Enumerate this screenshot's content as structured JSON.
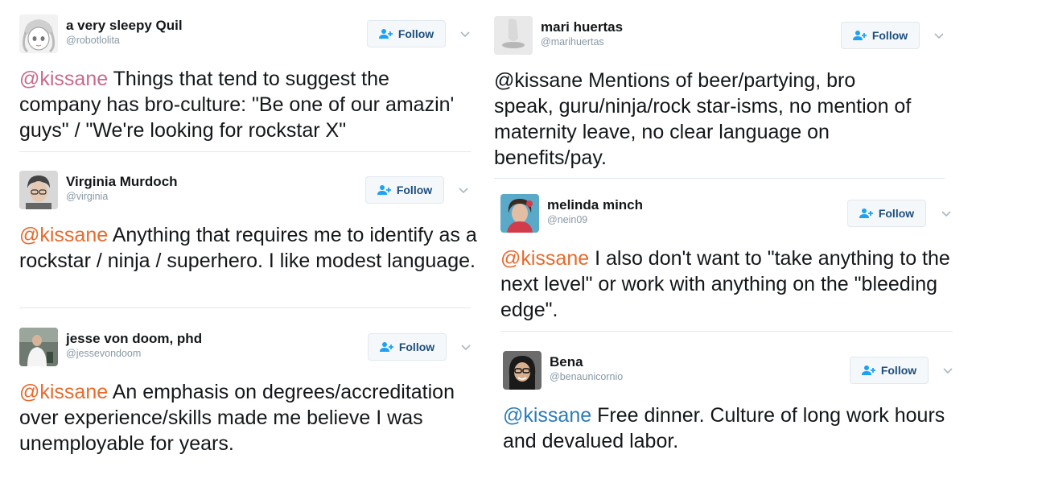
{
  "accent_mention_colors": {
    "pink": "#c96a8a",
    "orange": "#e86a2c",
    "blue": "#2b7bb9"
  },
  "tweets": [
    {
      "name": "a very sleepy Quil",
      "handle": "@robotlolita",
      "follow_label": "Follow",
      "mention": "@kissane",
      "text": " Things that tend to suggest the company has bro-culture: \"Be one of our amazin' guys\" / \"We're looking for rockstar X\"",
      "avatar_icon": "cartoon-girl-avatar"
    },
    {
      "name": "Virginia Murdoch",
      "handle": "@virginia",
      "follow_label": "Follow",
      "mention": "@kissane",
      "text": " Anything that requires me to identify as a rockstar / ninja / superhero. I like modest language.",
      "avatar_icon": "person-avatar"
    },
    {
      "name": "jesse von doom, phd",
      "handle": "@jessevondoom",
      "follow_label": "Follow",
      "mention": "@kissane",
      "text": " An emphasis on degrees/accreditation over experience/skills made me believe I was unemployable for years.",
      "avatar_icon": "person-avatar"
    },
    {
      "name": "mari huertas",
      "handle": "@marihuertas",
      "follow_label": "Follow",
      "mention": "@kissane",
      "text": " Mentions of beer/partying, bro speak, guru/ninja/rock star-isms, no mention of maternity leave, no clear language on benefits/pay.",
      "avatar_icon": "hand-avatar"
    },
    {
      "name": "melinda minch",
      "handle": "@nein09",
      "follow_label": "Follow",
      "mention": "@kissane",
      "text": " I also don't want to \"take anything to the next level\" or work with anything on the \"bleeding edge\".",
      "avatar_icon": "person-avatar"
    },
    {
      "name": "Bena",
      "handle": "@benaunicornio",
      "follow_label": "Follow",
      "mention": "@kissane",
      "text": " Free dinner. Culture of long work hours and devalued labor.",
      "avatar_icon": "person-avatar"
    }
  ]
}
